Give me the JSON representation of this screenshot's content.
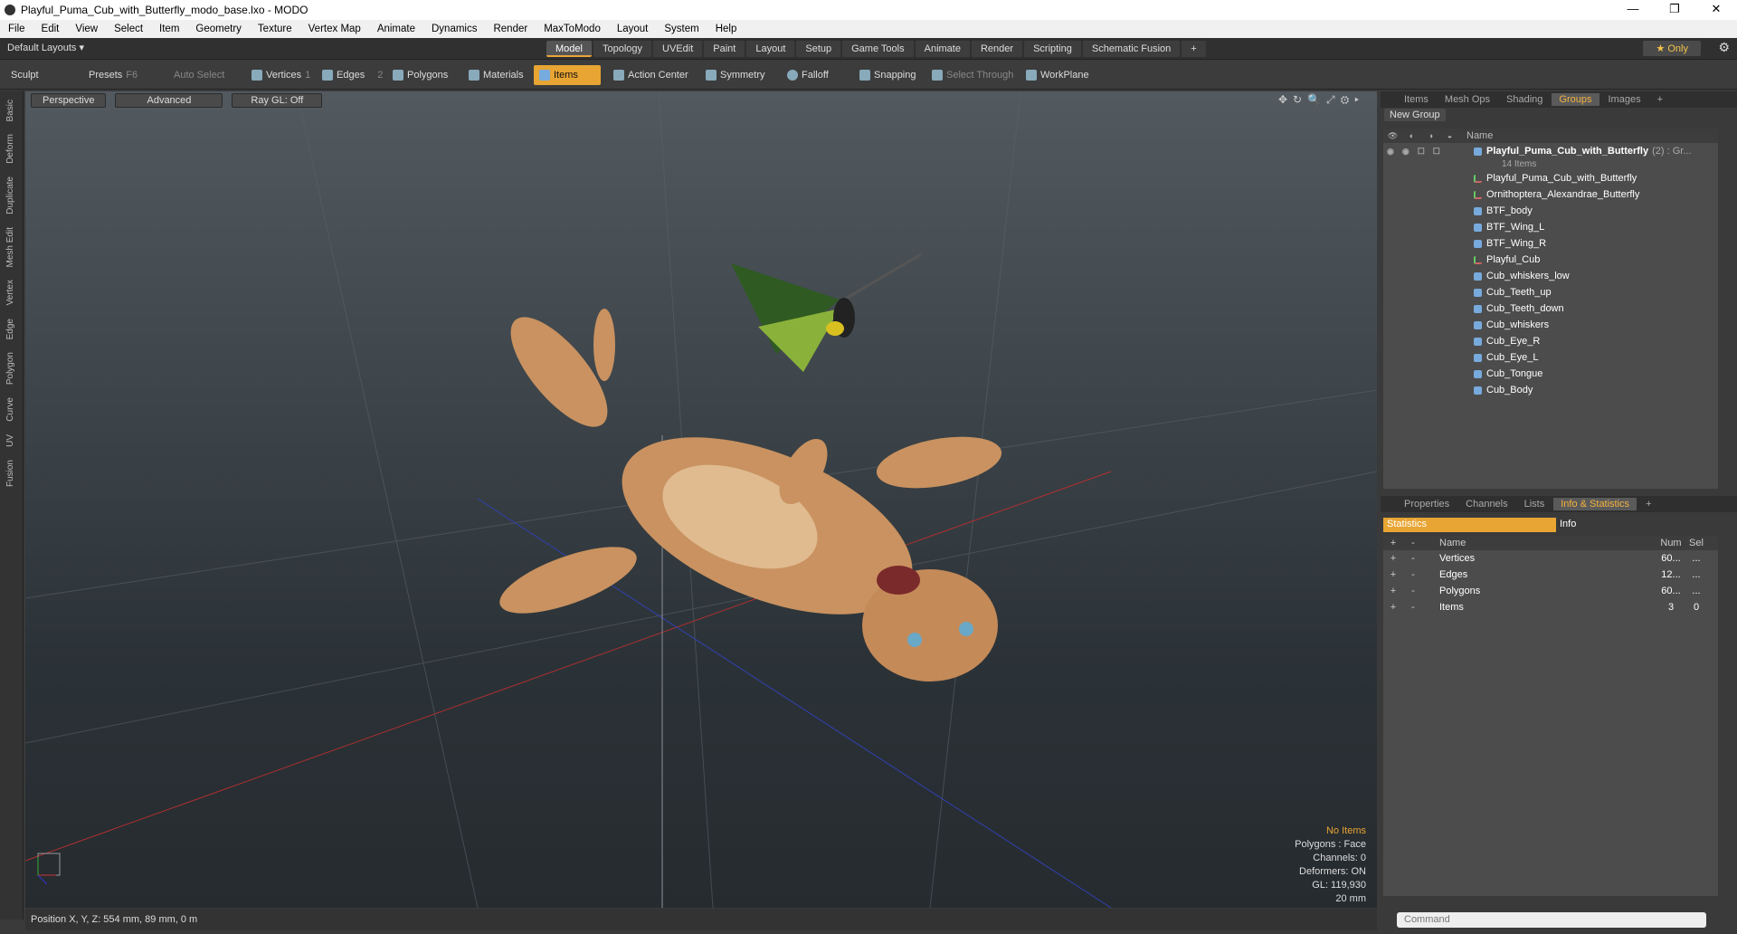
{
  "window": {
    "title": "Playful_Puma_Cub_with_Butterfly_modo_base.lxo - MODO",
    "controls": [
      "—",
      "❐",
      "✕"
    ]
  },
  "menu": [
    "File",
    "Edit",
    "View",
    "Select",
    "Item",
    "Geometry",
    "Texture",
    "Vertex Map",
    "Animate",
    "Dynamics",
    "Render",
    "MaxToModo",
    "Layout",
    "System",
    "Help"
  ],
  "layouts": "Default Layouts ▾",
  "top_tabs": [
    "Model",
    "Topology",
    "UVEdit",
    "Paint",
    "Layout",
    "Setup",
    "Game Tools",
    "Animate",
    "Render",
    "Scripting",
    "Schematic Fusion",
    "+"
  ],
  "only": "★ Only",
  "toolbar": {
    "sculpt": "Sculpt",
    "presets": "Presets",
    "presets_key": "F6",
    "auto_select": "Auto Select",
    "vertices": "Vertices",
    "vertices_n": "1",
    "edges": "Edges",
    "edges_n": "2",
    "polygons": "Polygons",
    "materials": "Materials",
    "items": "Items",
    "action_center": "Action Center",
    "symmetry": "Symmetry",
    "falloff": "Falloff",
    "snapping": "Snapping",
    "select_through": "Select Through",
    "workplane": "WorkPlane"
  },
  "left_tabs": [
    "Basic",
    "Deform",
    "Duplicate",
    "Mesh Edit",
    "Vertex",
    "Edge",
    "Polygon",
    "Curve",
    "UV",
    "Fusion"
  ],
  "viewport": {
    "perspective": "Perspective",
    "advanced": "Advanced",
    "raygl": "Ray GL: Off",
    "stats": [
      "No Items",
      "Polygons : Face",
      "Channels: 0",
      "Deformers: ON",
      "GL: 119,930",
      "20 mm"
    ]
  },
  "status": "Position X, Y, Z:   554 mm, 89 mm, 0 m",
  "top_panel": {
    "tabs": [
      "Items",
      "Mesh Ops",
      "Shading",
      "Groups",
      "Images",
      "+"
    ],
    "new_group": "New Group",
    "name_col": "Name",
    "group": {
      "name": "Playful_Puma_Cub_with_Butterfly",
      "count": "(2) : Gr...",
      "sub": "14 Items"
    },
    "items": [
      "Playful_Puma_Cub_with_Butterfly",
      "Ornithoptera_Alexandrae_Butterfly",
      "BTF_body",
      "BTF_Wing_L",
      "BTF_Wing_R",
      "Playful_Cub",
      "Cub_whiskers_low",
      "Cub_Teeth_up",
      "Cub_Teeth_down",
      "Cub_whiskers",
      "Cub_Eye_R",
      "Cub_Eye_L",
      "Cub_Tongue",
      "Cub_Body"
    ]
  },
  "bottom_panel": {
    "tabs": [
      "Properties",
      "Channels",
      "Lists",
      "Info & Statistics",
      "+"
    ],
    "statistics": "Statistics",
    "info": "Info",
    "cols": [
      "Name",
      "Num",
      "Sel"
    ],
    "rows": [
      {
        "name": "Vertices",
        "num": "60...",
        "sel": "..."
      },
      {
        "name": "Edges",
        "num": "12...",
        "sel": "..."
      },
      {
        "name": "Polygons",
        "num": "60...",
        "sel": "..."
      },
      {
        "name": "Items",
        "num": "3",
        "sel": "0"
      }
    ]
  },
  "command_placeholder": "Command"
}
